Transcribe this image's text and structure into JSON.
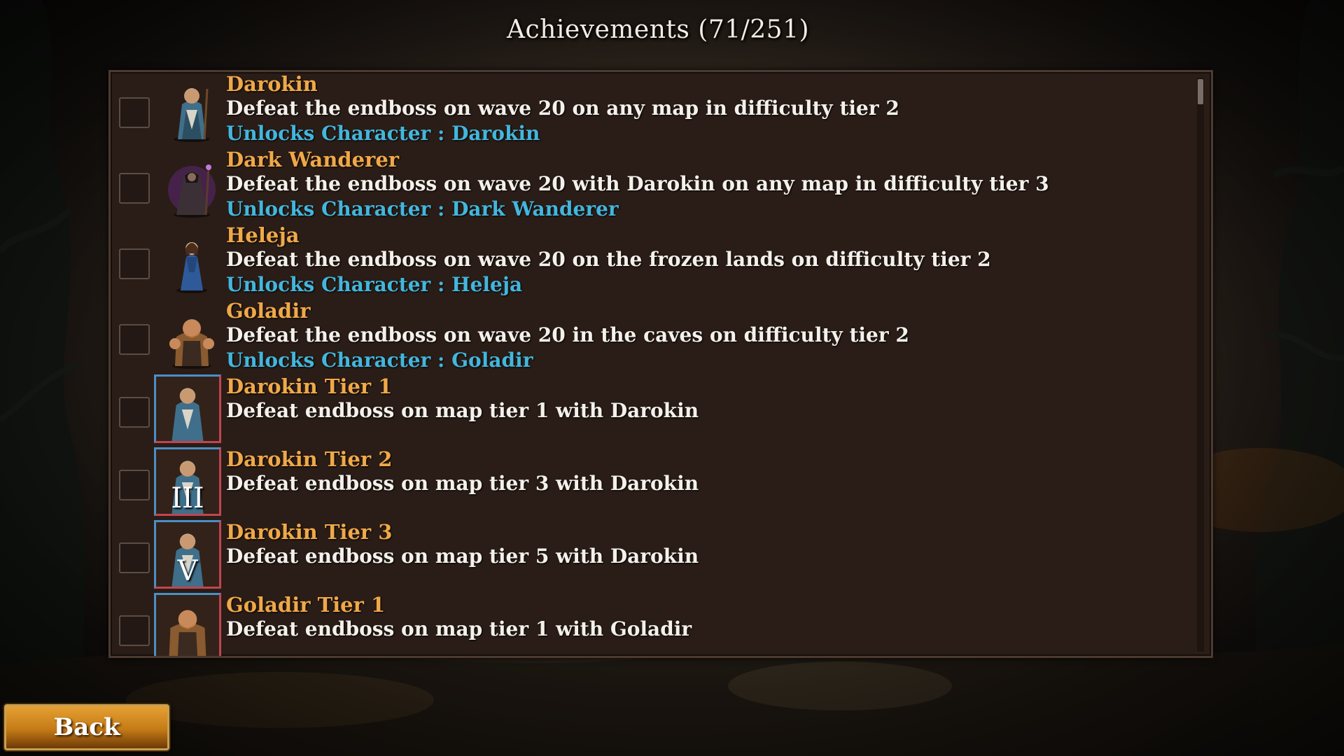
{
  "screen": {
    "title": "Achievements (71/251)"
  },
  "achievements": [
    {
      "name": "Darokin",
      "description": "Defeat the endboss on wave 20 on any map in difficulty tier 2",
      "reward": "Unlocks Character : Darokin",
      "portrait": "darokin-portrait-icon",
      "completed": false
    },
    {
      "name": "Dark Wanderer",
      "description": "Defeat the endboss on wave 20 with Darokin on any map in difficulty tier 3",
      "reward": "Unlocks Character : Dark Wanderer",
      "portrait": "dark-wanderer-portrait-icon",
      "completed": false
    },
    {
      "name": "Heleja",
      "description": "Defeat the endboss on wave 20 on the frozen lands on difficulty tier 2",
      "reward": "Unlocks Character : Heleja",
      "portrait": "heleja-portrait-icon",
      "completed": false
    },
    {
      "name": "Goladir",
      "description": "Defeat the endboss on wave 20 in the caves on difficulty tier 2",
      "reward": "Unlocks Character : Goladir",
      "portrait": "goladir-portrait-icon",
      "completed": false
    },
    {
      "name": "Darokin Tier 1",
      "description": "Defeat endboss on map tier 1 with Darokin",
      "badge": "",
      "portrait": "darokin-portrait-icon",
      "completed": false
    },
    {
      "name": "Darokin Tier 2",
      "description": "Defeat endboss on map tier 3 with Darokin",
      "badge": "III",
      "portrait": "darokin-portrait-icon",
      "completed": false
    },
    {
      "name": "Darokin Tier 3",
      "description": "Defeat endboss on map tier 5 with Darokin",
      "badge": "V",
      "portrait": "darokin-portrait-icon",
      "completed": false
    },
    {
      "name": "Goladir Tier 1",
      "description": "Defeat endboss on map tier 1 with Goladir",
      "badge": "",
      "portrait": "goladir-portrait-icon",
      "completed": false
    }
  ],
  "buttons": {
    "back_label": "Back"
  },
  "colors": {
    "name": "#f0a848",
    "description": "#f4f0ea",
    "reward": "#43b6dd",
    "panel": "#2a1d17",
    "tier_frame_blue": "#4b8fc6",
    "tier_frame_red": "#c04550"
  }
}
